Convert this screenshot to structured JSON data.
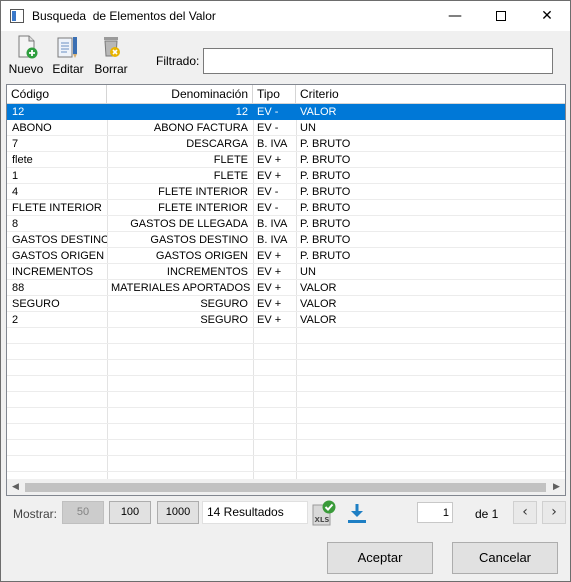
{
  "window": {
    "title": "Busqueda  de Elementos del Valor",
    "minimize": "—",
    "close": "✕"
  },
  "toolbar": {
    "nuevo": "Nuevo",
    "editar": "Editar",
    "borrar": "Borrar"
  },
  "filter": {
    "label": "Filtrado:",
    "value": ""
  },
  "table": {
    "columns": [
      "Código",
      "Denominación",
      "Tipo",
      "Criterio"
    ],
    "rows": [
      {
        "codigo": "12",
        "denominacion": "12",
        "tipo": "EV -",
        "criterio": "VALOR",
        "selected": true
      },
      {
        "codigo": "ABONO",
        "denominacion": "ABONO FACTURA",
        "tipo": "EV -",
        "criterio": "UN"
      },
      {
        "codigo": "7",
        "denominacion": "DESCARGA",
        "tipo": "B. IVA",
        "criterio": "P. BRUTO"
      },
      {
        "codigo": "flete",
        "denominacion": "FLETE",
        "tipo": "EV +",
        "criterio": "P. BRUTO"
      },
      {
        "codigo": "1",
        "denominacion": "FLETE",
        "tipo": "EV +",
        "criterio": "P. BRUTO"
      },
      {
        "codigo": "4",
        "denominacion": "FLETE INTERIOR",
        "tipo": "EV -",
        "criterio": "P. BRUTO"
      },
      {
        "codigo": "FLETE INTERIOR",
        "denominacion": "FLETE INTERIOR",
        "tipo": "EV -",
        "criterio": "P. BRUTO"
      },
      {
        "codigo": "8",
        "denominacion": "GASTOS DE LLEGADA",
        "tipo": "B. IVA",
        "criterio": "P. BRUTO"
      },
      {
        "codigo": "GASTOS DESTINO",
        "denominacion": "GASTOS DESTINO",
        "tipo": "B. IVA",
        "criterio": "P. BRUTO"
      },
      {
        "codigo": "GASTOS ORIGEN",
        "denominacion": "GASTOS ORIGEN",
        "tipo": "EV +",
        "criterio": "P. BRUTO"
      },
      {
        "codigo": "INCREMENTOS",
        "denominacion": "INCREMENTOS",
        "tipo": "EV +",
        "criterio": "UN"
      },
      {
        "codigo": "88",
        "denominacion": "MATERIALES APORTADOS",
        "tipo": "EV +",
        "criterio": "VALOR"
      },
      {
        "codigo": "SEGURO",
        "denominacion": "SEGURO",
        "tipo": "EV +",
        "criterio": "VALOR"
      },
      {
        "codigo": "2",
        "denominacion": "SEGURO",
        "tipo": "EV +",
        "criterio": "VALOR"
      }
    ]
  },
  "pager": {
    "mostrar_label": "Mostrar:",
    "size_options": [
      "50",
      "100",
      "1000"
    ],
    "results": "14 Resultados",
    "current_page": "1",
    "of_label": "de 1",
    "prev": "‹",
    "next": "›"
  },
  "dialog": {
    "ok": "Aceptar",
    "cancel": "Cancelar"
  },
  "colors": {
    "selection": "#0078d7",
    "xls_green": "#3a9b3a",
    "download_blue": "#1e7fc4"
  }
}
